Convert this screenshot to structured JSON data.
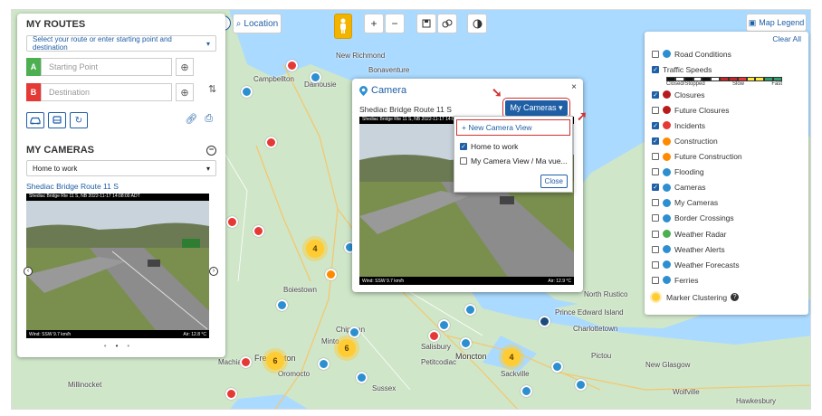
{
  "map": {
    "location_button": "Location",
    "zoom_in": "+",
    "zoom_out": "−",
    "places": [
      {
        "name": "Campbellton"
      },
      {
        "name": "Dalhousie"
      },
      {
        "name": "New Richmond"
      },
      {
        "name": "Bonaventure"
      },
      {
        "name": "Boiestown"
      },
      {
        "name": "Chipman"
      },
      {
        "name": "Minto"
      },
      {
        "name": "Salisbury"
      },
      {
        "name": "Moncton"
      },
      {
        "name": "Sackville"
      },
      {
        "name": "Fredericton"
      },
      {
        "name": "Oromocto"
      },
      {
        "name": "Sussex"
      },
      {
        "name": "Petitcodiac"
      },
      {
        "name": "Millinocket"
      },
      {
        "name": "Machias"
      },
      {
        "name": "North Rustico"
      },
      {
        "name": "Prince Edward Island"
      },
      {
        "name": "Charlottetown"
      },
      {
        "name": "Pictou"
      },
      {
        "name": "New Glasgow"
      },
      {
        "name": "Wolfville"
      },
      {
        "name": "Hawkesbury"
      }
    ],
    "clusters": [
      "4",
      "6",
      "6",
      "4"
    ]
  },
  "routes": {
    "title": "MY ROUTES",
    "select_placeholder": "Select your route or enter starting point and destination",
    "start_badge": "A",
    "start_placeholder": "Starting Point",
    "end_badge": "B",
    "end_placeholder": "Destination"
  },
  "my_cameras": {
    "title": "MY CAMERAS",
    "selected_view": "Home to work",
    "camera_link": "Shediac Bridge Route 11 S",
    "image_caption": "Shediac Bridge Rte 11 S, NB 2022-11-17 14:08:00 ADT",
    "image_footer_left": "Wind: SSW 9.7 km/h",
    "image_footer_right": "Air: 12.8 °C"
  },
  "camera_popup": {
    "title": "Camera",
    "close": "×",
    "camera_name": "Shediac Bridge Route 11 S",
    "my_cameras_button": "My Cameras ▾",
    "image_caption": "Shediac Bridge Rte 11 S, NB 2022-11-17 14:08:00 ADT",
    "image_footer_left": "Wind: SSW 9.7 km/h",
    "image_footer_right": "Air: 12.9 °C",
    "dropdown": {
      "new_view": "+ New Camera View",
      "items": [
        {
          "label": "Home to work",
          "checked": true
        },
        {
          "label": "My Camera View / Ma vue...",
          "checked": false
        }
      ],
      "close_button": "Close"
    }
  },
  "legend": {
    "button": "Map Legend",
    "clear_all": "Clear All",
    "speed_labels": {
      "closed": "Closed/Stopped",
      "slow": "Slow",
      "fast": "Fast"
    },
    "items": [
      {
        "label": "Road Conditions",
        "checked": false,
        "color": "#2d8fd0"
      },
      {
        "label": "Traffic Speeds",
        "checked": true,
        "color": ""
      },
      {
        "label": "Closures",
        "checked": true,
        "color": "#b71c1c"
      },
      {
        "label": "Future Closures",
        "checked": false,
        "color": "#b71c1c"
      },
      {
        "label": "Incidents",
        "checked": true,
        "color": "#e53935"
      },
      {
        "label": "Construction",
        "checked": true,
        "color": "#ff8a00"
      },
      {
        "label": "Future Construction",
        "checked": false,
        "color": "#ff8a00"
      },
      {
        "label": "Flooding",
        "checked": false,
        "color": "#2d8fd0"
      },
      {
        "label": "Cameras",
        "checked": true,
        "color": "#2d8fd0"
      },
      {
        "label": "My Cameras",
        "checked": false,
        "color": "#2d8fd0"
      },
      {
        "label": "Border Crossings",
        "checked": false,
        "color": "#2d8fd0"
      },
      {
        "label": "Weather Radar",
        "checked": false,
        "color": "#4caf50"
      },
      {
        "label": "Weather Alerts",
        "checked": false,
        "color": "#2d8fd0"
      },
      {
        "label": "Weather Forecasts",
        "checked": false,
        "color": "#2d8fd0"
      },
      {
        "label": "Ferries",
        "checked": false,
        "color": "#2d8fd0"
      }
    ],
    "clustering_label": "Marker Clustering"
  }
}
